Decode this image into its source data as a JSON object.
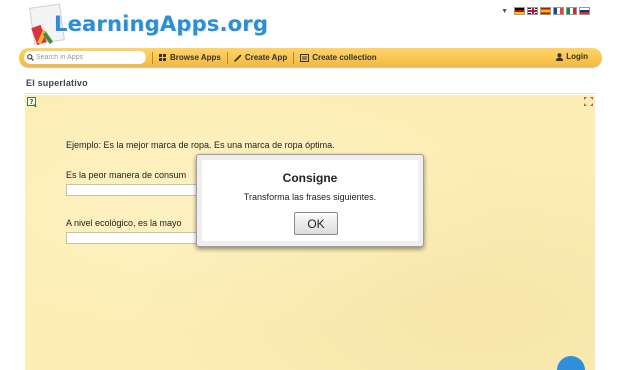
{
  "header": {
    "logo_text": "LearningApps.org",
    "languages": [
      {
        "icon": "flag-germany-icon",
        "colors": [
          "#000000",
          "#dd0000",
          "#ffce00"
        ]
      },
      {
        "icon": "flag-uk-icon",
        "colors": [
          "#012169",
          "#ffffff",
          "#c8102e"
        ]
      },
      {
        "icon": "flag-spain-icon",
        "colors": [
          "#aa151b",
          "#f1bf00",
          "#aa151b"
        ]
      },
      {
        "icon": "flag-france-icon",
        "colors": [
          "#0055a4",
          "#ffffff",
          "#ef4135"
        ]
      },
      {
        "icon": "flag-italy-icon",
        "colors": [
          "#009246",
          "#ffffff",
          "#ce2b37"
        ]
      },
      {
        "icon": "flag-russia-icon",
        "colors": [
          "#ffffff",
          "#0039a6",
          "#d52b1e"
        ]
      }
    ]
  },
  "nav": {
    "search_placeholder": "Search in Apps",
    "browse_label": "Browse Apps",
    "create_label": "Create App",
    "collection_label": "Create collection",
    "login_label": "Login"
  },
  "page": {
    "title": "El superlativo"
  },
  "exercise": {
    "example": "Ejemplo: Es la mejor marca de ropa. Es una marca de ropa óptima.",
    "sentence_1": "Es la peor manera de consum",
    "sentence_2": "A nivel ecológico, es la mayo",
    "answer_1": "",
    "answer_2": ""
  },
  "dialog": {
    "title": "Consigne",
    "text": "Transforma las frases siguientes.",
    "ok_label": "OK"
  },
  "colors": {
    "nav_bar": "#f3b93c",
    "stage_background": "#fdeeb4",
    "logo_blue": "#2a8fd6"
  }
}
